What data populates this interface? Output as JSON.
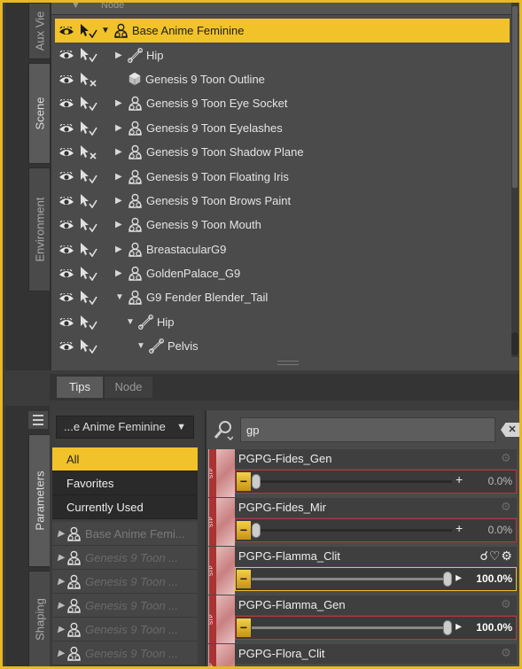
{
  "side_tabs_top": [
    {
      "label": "Aux Vie"
    },
    {
      "label": "Scene",
      "active": true
    },
    {
      "label": "Environment"
    }
  ],
  "side_tabs_bottom": [
    {
      "label": "Parameters",
      "active": true
    },
    {
      "label": "Shaping"
    }
  ],
  "scene_header": {
    "col1": "▼",
    "col2": "Node"
  },
  "scene_rows": [
    {
      "label": "Base Anime Feminine",
      "expander": "▼",
      "icon": "figure-icon",
      "selected": true,
      "pointer_state": "selectable"
    },
    {
      "label": "Hip",
      "expander": "▶",
      "icon": "bone-icon",
      "pointer_state": "selectable"
    },
    {
      "label": "Genesis 9 Toon Outline",
      "expander": "",
      "icon": "cube-icon",
      "pointer_state": "locked"
    },
    {
      "label": "Genesis 9 Toon Eye Socket",
      "expander": "▶",
      "icon": "figure-icon",
      "pointer_state": "selectable"
    },
    {
      "label": "Genesis 9 Toon Eyelashes",
      "expander": "▶",
      "icon": "figure-icon",
      "pointer_state": "selectable"
    },
    {
      "label": "Genesis 9 Toon Shadow Plane",
      "expander": "▶",
      "icon": "figure-icon",
      "pointer_state": "locked"
    },
    {
      "label": "Genesis 9 Toon Floating Iris",
      "expander": "▶",
      "icon": "figure-icon",
      "pointer_state": "selectable"
    },
    {
      "label": "Genesis 9 Toon Brows Paint",
      "expander": "▶",
      "icon": "figure-icon",
      "pointer_state": "selectable"
    },
    {
      "label": "Genesis 9 Toon Mouth",
      "expander": "▶",
      "icon": "figure-icon",
      "pointer_state": "selectable"
    },
    {
      "label": "BreastacularG9",
      "expander": "▶",
      "icon": "figure-icon",
      "pointer_state": "selectable"
    },
    {
      "label": "GoldenPalace_G9",
      "expander": "▶",
      "icon": "figure-icon",
      "pointer_state": "selectable"
    },
    {
      "label": "G9 Fender Blender_Tail",
      "expander": "▼",
      "icon": "figure-icon",
      "pointer_state": "selectable"
    },
    {
      "label": "Hip",
      "expander": "▼",
      "icon": "bone-icon",
      "pointer_state": "selectable"
    },
    {
      "label": "Pelvis",
      "expander": "▼",
      "icon": "bone-icon",
      "pointer_state": "selectable"
    }
  ],
  "bottom_tabs": {
    "tips": "Tips",
    "node": "Node"
  },
  "params": {
    "dropdown_value": "...e Anime Feminine",
    "dropdown_caret": "▼",
    "filters": [
      {
        "label": "All",
        "active": true
      },
      {
        "label": "Favorites"
      },
      {
        "label": "Currently Used"
      }
    ],
    "nodes": [
      {
        "label": "Base Anime Femi..."
      },
      {
        "label": "Genesis 9 Toon ..."
      },
      {
        "label": "Genesis 9 Toon ..."
      },
      {
        "label": "Genesis 9 Toon ..."
      },
      {
        "label": "Genesis 9 Toon ..."
      },
      {
        "label": "Genesis 9 Toon ..."
      }
    ],
    "search_value": "gp",
    "clear_label": "✕",
    "properties": [
      {
        "name": "PGPG-Fides_Gen",
        "value": "0.0%",
        "fraction": 0.0,
        "selected": false,
        "show_plus": true
      },
      {
        "name": "PGPG-Fides_Mir",
        "value": "0.0%",
        "fraction": 0.0,
        "selected": false,
        "show_plus": true
      },
      {
        "name": "PGPG-Flamma_Clit",
        "value": "100.0%",
        "fraction": 1.0,
        "selected": true,
        "show_plus": false
      },
      {
        "name": "PGPG-Flamma_Gen",
        "value": "100.0%",
        "fraction": 1.0,
        "selected": false,
        "show_plus": false
      },
      {
        "name": "PGPG-Flora_Clit",
        "value": "",
        "fraction": 0.0,
        "selected": false,
        "show_plus": false
      }
    ],
    "thumb_badge": "STP"
  },
  "colors": {
    "accent": "#f2c22a",
    "frame": "#e8b923",
    "slider_border": "#b43a3a"
  }
}
